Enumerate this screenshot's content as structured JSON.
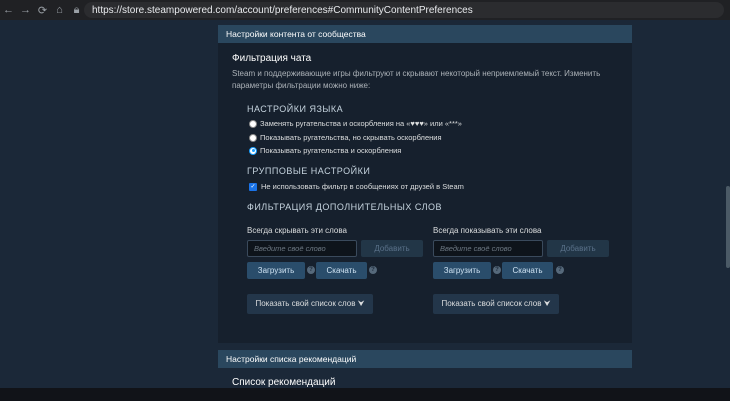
{
  "browser": {
    "url": "https://store.steampowered.com/account/preferences#CommunityContentPreferences",
    "icons": [
      "back-arrow-icon",
      "forward-arrow-icon",
      "reload-icon",
      "home-icon",
      "lock-icon"
    ]
  },
  "community_section": {
    "header": "Настройки контента от сообщества",
    "chat_filter": {
      "title": "Фильтрация чата",
      "description": "Steam и поддерживающие игры фильтруют и скрывают некоторый неприемлемый текст. Изменить параметры фильтрации можно ниже:"
    },
    "language": {
      "label": "НАСТРОЙКИ ЯЗЫКА",
      "options": [
        {
          "label": "Заменять ругательства и оскорбления на «♥♥♥» или «***»",
          "checked": false
        },
        {
          "label": "Показывать ругательства, но скрывать оскорбления",
          "checked": false
        },
        {
          "label": "Показывать ругательства и оскорбления",
          "checked": true
        }
      ]
    },
    "group": {
      "label": "ГРУППОВЫЕ НАСТРОЙКИ",
      "option": {
        "label": "Не использовать фильтр в сообщениях от друзей в Steam",
        "checked": true
      }
    },
    "extra": {
      "label": "ФИЛЬТРАЦИЯ ДОПОЛНИТЕЛЬНЫХ СЛОВ",
      "hide_col": {
        "title": "Всегда скрывать эти слова",
        "placeholder": "Введите своё слово",
        "add": "Добавить",
        "upload": "Загрузить",
        "download": "Скачать",
        "show_list": "Показать свой список слов ⮟"
      },
      "show_col": {
        "title": "Всегда показывать эти слова",
        "placeholder": "Введите своё слово",
        "add": "Добавить",
        "upload": "Загрузить",
        "download": "Скачать",
        "show_list": "Показать свой список слов ⮟"
      },
      "help_glyph": "?"
    }
  },
  "recommendations_section": {
    "header": "Настройки списка рекомендаций",
    "title": "Список рекомендаций"
  }
}
